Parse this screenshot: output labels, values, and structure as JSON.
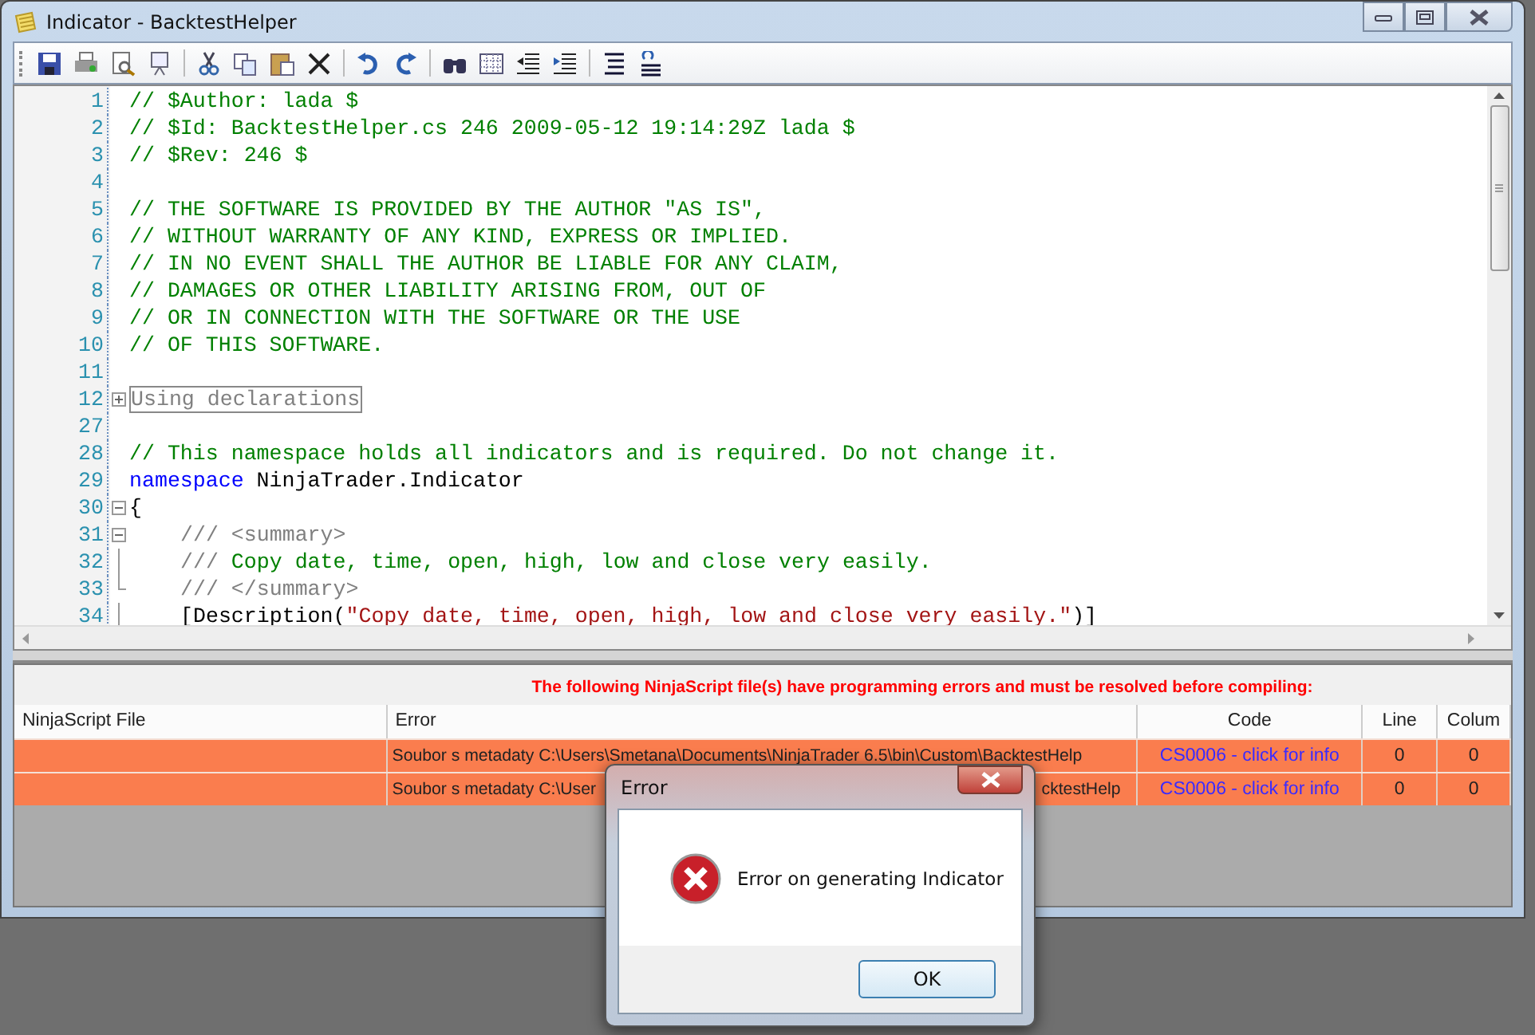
{
  "window": {
    "title": "Indicator - BacktestHelper"
  },
  "editor": {
    "lines": [
      {
        "number": "1",
        "segments": [
          {
            "kind": "comment",
            "text": "// $Author: lada $"
          }
        ]
      },
      {
        "number": "2",
        "segments": [
          {
            "kind": "comment",
            "text": "// $Id: BacktestHelper.cs 246 2009-05-12 19:14:29Z lada $"
          }
        ]
      },
      {
        "number": "3",
        "segments": [
          {
            "kind": "comment",
            "text": "// $Rev: 246 $"
          }
        ]
      },
      {
        "number": "4"
      },
      {
        "number": "5",
        "segments": [
          {
            "kind": "comment",
            "text": "// THE SOFTWARE IS PROVIDED BY THE AUTHOR \"AS IS\","
          }
        ]
      },
      {
        "number": "6",
        "segments": [
          {
            "kind": "comment",
            "text": "// WITHOUT WARRANTY OF ANY KIND, EXPRESS OR IMPLIED."
          }
        ]
      },
      {
        "number": "7",
        "segments": [
          {
            "kind": "comment",
            "text": "// IN NO EVENT SHALL THE AUTHOR BE LIABLE FOR ANY CLAIM,"
          }
        ]
      },
      {
        "number": "8",
        "segments": [
          {
            "kind": "comment",
            "text": "// DAMAGES OR OTHER LIABILITY ARISING FROM, OUT OF"
          }
        ]
      },
      {
        "number": "9",
        "segments": [
          {
            "kind": "comment",
            "text": "// OR IN CONNECTION WITH THE SOFTWARE OR THE USE"
          }
        ]
      },
      {
        "number": "10",
        "segments": [
          {
            "kind": "comment",
            "text": "// OF THIS SOFTWARE."
          }
        ]
      },
      {
        "number": "11"
      },
      {
        "number": "12",
        "kind": "expander",
        "segments": [
          {
            "kind": "region",
            "text": "Using declarations"
          }
        ]
      },
      {
        "number": "27"
      },
      {
        "number": "28",
        "segments": [
          {
            "kind": "comment",
            "text": "// This namespace holds all indicators and is required. Do not change it."
          }
        ]
      },
      {
        "number": "29",
        "segments": [
          {
            "kind": "keyword",
            "text": "namespace"
          },
          {
            "kind": "plain",
            "text": " NinjaTrader.Indicator"
          }
        ]
      },
      {
        "number": "30",
        "kind": "collapser",
        "segments": [
          {
            "kind": "plain",
            "text": "{"
          }
        ]
      },
      {
        "number": "31",
        "kind": "collapser",
        "indented": true,
        "segments": [
          {
            "kind": "doc",
            "text": "/// <summary>"
          }
        ]
      },
      {
        "number": "32",
        "kind": "guide",
        "indented": true,
        "segments": [
          {
            "kind": "doc",
            "text": "///"
          },
          {
            "kind": "comment",
            "text": " Copy date, time, open, high, low and close very easily."
          }
        ]
      },
      {
        "number": "33",
        "kind": "foldend",
        "indented": true,
        "segments": [
          {
            "kind": "doc",
            "text": "/// </summary>"
          }
        ]
      },
      {
        "number": "34",
        "kind": "guide",
        "indented": true,
        "segments": [
          {
            "kind": "plain",
            "text": "[Description("
          },
          {
            "kind": "string",
            "text": "\"Copy date, time, open, high, low and close very easily.\""
          },
          {
            "kind": "plain",
            "text": ")]"
          }
        ]
      }
    ]
  },
  "errors": {
    "message": "The following NinjaScript file(s) have programming errors and must be resolved before compiling:",
    "columns": [
      "NinjaScript File",
      "Error",
      "Code",
      "Line",
      "Colum"
    ],
    "rows": [
      {
        "error": "Soubor s metadaty C:\\Users\\Smetana\\Documents\\NinjaTrader 6.5\\bin\\Custom\\BacktestHelp",
        "code": "CS0006 - click for info",
        "line": "0",
        "column": "0"
      },
      {
        "error": "Soubor s metadaty C:\\User",
        "error_tail": "cktestHelp",
        "code": "CS0006 - click for info",
        "line": "0",
        "column": "0"
      }
    ]
  },
  "dialog": {
    "title": "Error",
    "message": "Error on generating Indicator",
    "button": "OK"
  }
}
